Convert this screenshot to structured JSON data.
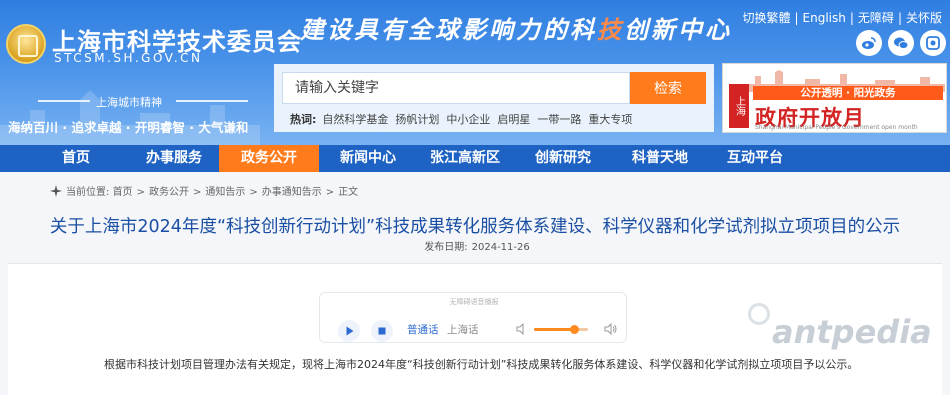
{
  "header": {
    "site_name": "上海市科学技术委员会",
    "site_domain": "STCSM.SH.GOV.CN",
    "slogan_title": "上海城市精神",
    "city_spirit": "海纳百川 · 追求卓越 · 开明睿智 · 大气谦和",
    "calligraphy": [
      "建设具有全球影响力的科",
      "技",
      "创新中心"
    ],
    "top_links": [
      "切换繁體",
      "English",
      "无障碍",
      "关怀版"
    ],
    "top_link_sep": "|"
  },
  "search": {
    "placeholder": "请输入关键字",
    "button_label": "检索",
    "hot_label": "热词:",
    "hot_terms": [
      "自然科学基金",
      "扬帆计划",
      "中小企业",
      "启明星",
      "一带一路",
      "重大专项"
    ]
  },
  "banner": {
    "side_text": "上海",
    "ribbon": "公开透明 · 阳光政务",
    "main_text": "政府开放月",
    "english": "Shanghai Municipal People's Government open month"
  },
  "nav": {
    "items": [
      "首页",
      "办事服务",
      "政务公开",
      "新闻中心",
      "张江高新区",
      "创新研究",
      "科普天地",
      "互动平台"
    ],
    "active_index": 2
  },
  "breadcrumb": {
    "prefix": "当前位置:",
    "items": [
      "首页",
      "政务公开",
      "通知告示",
      "办事通知告示",
      "正文"
    ],
    "sep": ">"
  },
  "article": {
    "title": "关于上海市2024年度“科技创新行动计划”科技成果转化服务体系建设、科学仪器和化学试剂拟立项项目的公示",
    "date_label": "发布日期:",
    "date_value": "2024-11-26",
    "paragraph": "根据市科技计划项目管理办法有关规定，现将上海市2024年度“科技创新行动计划”科技成果转化服务体系建设、科学仪器和化学试剂拟立项项目予以公示。"
  },
  "player": {
    "header": "无障碍语音播报",
    "lang_mandarin": "普通话",
    "lang_shanghai": "上海话",
    "volume": 0.75
  },
  "watermark": "antpedia",
  "colors": {
    "nav_bg": "#1e63c4",
    "nav_active": "#ff7b1c",
    "search_button": "#ff7b1c",
    "title": "#1b4fa3"
  }
}
